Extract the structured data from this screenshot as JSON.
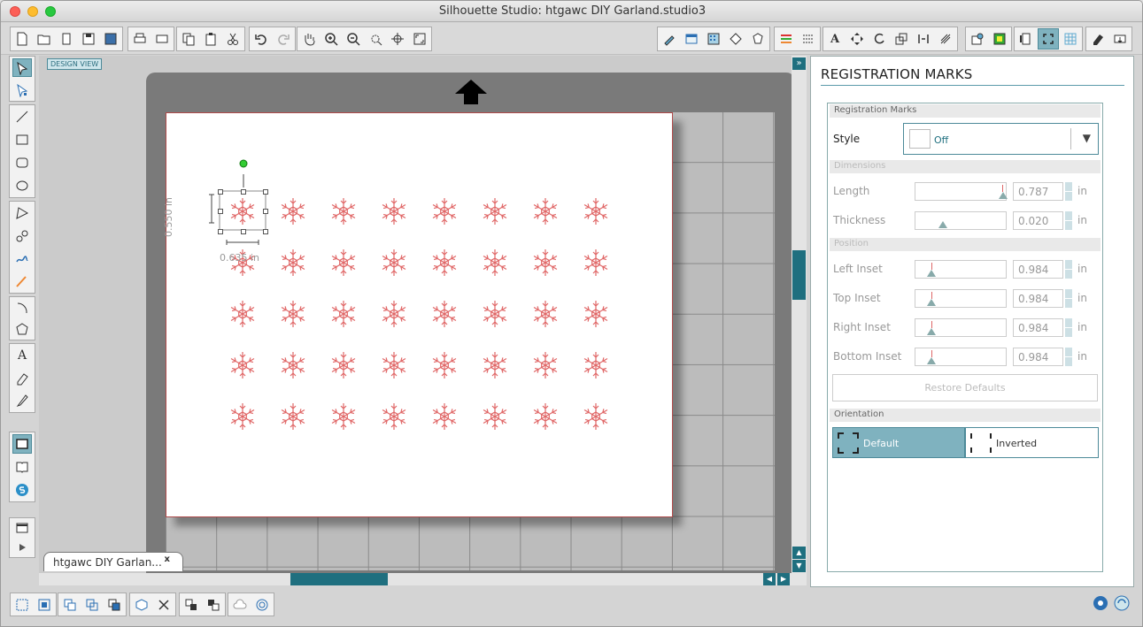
{
  "window": {
    "title": "Silhouette Studio: htgawc DIY Garland.studio3"
  },
  "canvas": {
    "view_label": "DESIGN VIEW",
    "dim_height": "0.550 in",
    "dim_width": "0.635 in",
    "doc_tab": "htgawc DIY Garlan...",
    "doc_tab_close": "x"
  },
  "panel": {
    "title": "REGISTRATION MARKS",
    "section_registration": "Registration Marks",
    "style_label": "Style",
    "style_value": "Off",
    "section_dimensions": "Dimensions",
    "length_label": "Length",
    "length_value": "0.787",
    "thickness_label": "Thickness",
    "thickness_value": "0.020",
    "section_position": "Position",
    "left_inset_label": "Left Inset",
    "left_inset_value": "0.984",
    "top_inset_label": "Top Inset",
    "top_inset_value": "0.984",
    "right_inset_label": "Right Inset",
    "right_inset_value": "0.984",
    "bottom_inset_label": "Bottom Inset",
    "bottom_inset_value": "0.984",
    "unit": "in",
    "restore_label": "Restore Defaults",
    "section_orientation": "Orientation",
    "orientation_default": "Default",
    "orientation_inverted": "Inverted"
  },
  "colors": {
    "accent": "#7fb2bf",
    "snowflake": "#e06666",
    "scroll": "#1f6f7f"
  }
}
